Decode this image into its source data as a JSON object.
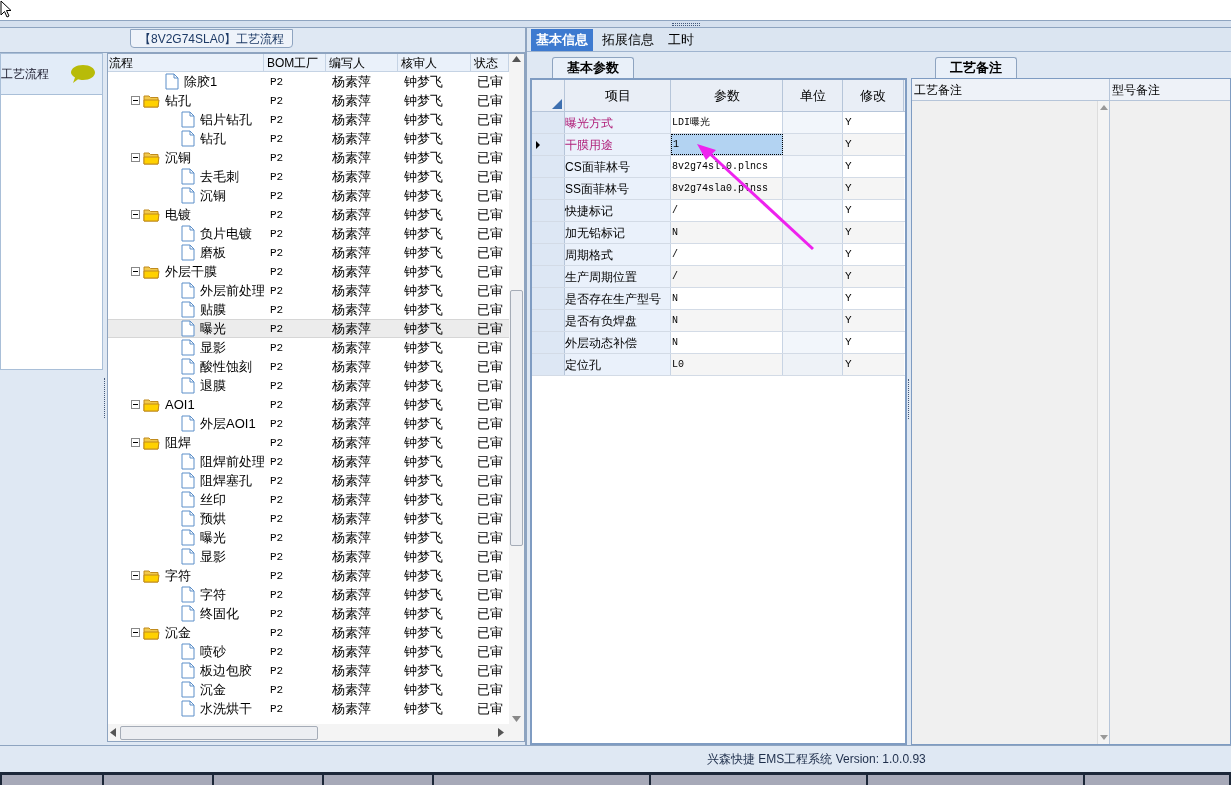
{
  "flow_tab": {
    "title": "【8V2G74SLA0】工艺流程"
  },
  "sidebar": {
    "title": "工艺流程"
  },
  "flow_tree": {
    "columns": [
      "流程",
      "BOM工厂",
      "编写人",
      "核审人",
      "状态"
    ],
    "items": [
      {
        "name": "除胶1",
        "bom": "P2",
        "writer": "杨素萍",
        "reviewer": "钟梦飞",
        "status": "已审",
        "selected": false
      },
      {
        "name": "钻孔",
        "bom": "P2",
        "writer": "杨素萍",
        "reviewer": "钟梦飞",
        "status": "已审",
        "selected": false,
        "expanded": true,
        "children": [
          {
            "name": "铝片钻孔",
            "bom": "P2",
            "writer": "杨素萍",
            "reviewer": "钟梦飞",
            "status": "已审",
            "selected": false
          },
          {
            "name": "钻孔",
            "bom": "P2",
            "writer": "杨素萍",
            "reviewer": "钟梦飞",
            "status": "已审",
            "selected": false
          }
        ]
      },
      {
        "name": "沉铜",
        "bom": "P2",
        "writer": "杨素萍",
        "reviewer": "钟梦飞",
        "status": "已审",
        "selected": false,
        "expanded": true,
        "children": [
          {
            "name": "去毛刺",
            "bom": "P2",
            "writer": "杨素萍",
            "reviewer": "钟梦飞",
            "status": "已审",
            "selected": false
          },
          {
            "name": "沉铜",
            "bom": "P2",
            "writer": "杨素萍",
            "reviewer": "钟梦飞",
            "status": "已审",
            "selected": false
          }
        ]
      },
      {
        "name": "电镀",
        "bom": "P2",
        "writer": "杨素萍",
        "reviewer": "钟梦飞",
        "status": "已审",
        "selected": false,
        "expanded": true,
        "children": [
          {
            "name": "负片电镀",
            "bom": "P2",
            "writer": "杨素萍",
            "reviewer": "钟梦飞",
            "status": "已审",
            "selected": false
          },
          {
            "name": "磨板",
            "bom": "P2",
            "writer": "杨素萍",
            "reviewer": "钟梦飞",
            "status": "已审",
            "selected": false
          }
        ]
      },
      {
        "name": "外层干膜",
        "bom": "P2",
        "writer": "杨素萍",
        "reviewer": "钟梦飞",
        "status": "已审",
        "selected": false,
        "expanded": true,
        "children": [
          {
            "name": "外层前处理",
            "bom": "P2",
            "writer": "杨素萍",
            "reviewer": "钟梦飞",
            "status": "已审",
            "selected": false
          },
          {
            "name": "贴膜",
            "bom": "P2",
            "writer": "杨素萍",
            "reviewer": "钟梦飞",
            "status": "已审",
            "selected": false
          },
          {
            "name": "曝光",
            "bom": "P2",
            "writer": "杨素萍",
            "reviewer": "钟梦飞",
            "status": "已审",
            "selected": true
          },
          {
            "name": "显影",
            "bom": "P2",
            "writer": "杨素萍",
            "reviewer": "钟梦飞",
            "status": "已审",
            "selected": false
          },
          {
            "name": "酸性蚀刻",
            "bom": "P2",
            "writer": "杨素萍",
            "reviewer": "钟梦飞",
            "status": "已审",
            "selected": false
          },
          {
            "name": "退膜",
            "bom": "P2",
            "writer": "杨素萍",
            "reviewer": "钟梦飞",
            "status": "已审",
            "selected": false
          }
        ]
      },
      {
        "name": "AOI1",
        "bom": "P2",
        "writer": "杨素萍",
        "reviewer": "钟梦飞",
        "status": "已审",
        "selected": false,
        "expanded": true,
        "children": [
          {
            "name": "外层AOI1",
            "bom": "P2",
            "writer": "杨素萍",
            "reviewer": "钟梦飞",
            "status": "已审",
            "selected": false
          }
        ]
      },
      {
        "name": "阻焊",
        "bom": "P2",
        "writer": "杨素萍",
        "reviewer": "钟梦飞",
        "status": "已审",
        "selected": false,
        "expanded": true,
        "children": [
          {
            "name": "阻焊前处理",
            "bom": "P2",
            "writer": "杨素萍",
            "reviewer": "钟梦飞",
            "status": "已审",
            "selected": false
          },
          {
            "name": "阻焊塞孔",
            "bom": "P2",
            "writer": "杨素萍",
            "reviewer": "钟梦飞",
            "status": "已审",
            "selected": false
          },
          {
            "name": "丝印",
            "bom": "P2",
            "writer": "杨素萍",
            "reviewer": "钟梦飞",
            "status": "已审",
            "selected": false
          },
          {
            "name": "预烘",
            "bom": "P2",
            "writer": "杨素萍",
            "reviewer": "钟梦飞",
            "status": "已审",
            "selected": false
          },
          {
            "name": "曝光",
            "bom": "P2",
            "writer": "杨素萍",
            "reviewer": "钟梦飞",
            "status": "已审",
            "selected": false
          },
          {
            "name": "显影",
            "bom": "P2",
            "writer": "杨素萍",
            "reviewer": "钟梦飞",
            "status": "已审",
            "selected": false
          }
        ]
      },
      {
        "name": "字符",
        "bom": "P2",
        "writer": "杨素萍",
        "reviewer": "钟梦飞",
        "status": "已审",
        "selected": false,
        "expanded": true,
        "children": [
          {
            "name": "字符",
            "bom": "P2",
            "writer": "杨素萍",
            "reviewer": "钟梦飞",
            "status": "已审",
            "selected": false
          },
          {
            "name": "终固化",
            "bom": "P2",
            "writer": "杨素萍",
            "reviewer": "钟梦飞",
            "status": "已审",
            "selected": false
          }
        ]
      },
      {
        "name": "沉金",
        "bom": "P2",
        "writer": "杨素萍",
        "reviewer": "钟梦飞",
        "status": "已审",
        "selected": false,
        "expanded": true,
        "children": [
          {
            "name": "喷砂",
            "bom": "P2",
            "writer": "杨素萍",
            "reviewer": "钟梦飞",
            "status": "已审",
            "selected": false
          },
          {
            "name": "板边包胶",
            "bom": "P2",
            "writer": "杨素萍",
            "reviewer": "钟梦飞",
            "status": "已审",
            "selected": false
          },
          {
            "name": "沉金",
            "bom": "P2",
            "writer": "杨素萍",
            "reviewer": "钟梦飞",
            "status": "已审",
            "selected": false
          },
          {
            "name": "水洗烘干",
            "bom": "P2",
            "writer": "杨素萍",
            "reviewer": "钟梦飞",
            "status": "已审",
            "selected": false
          }
        ]
      }
    ]
  },
  "tabs": [
    {
      "label": "基本信息",
      "selected": true
    },
    {
      "label": "拓展信息",
      "selected": false
    },
    {
      "label": "工时",
      "selected": false
    }
  ],
  "params": {
    "tab": "基本参数",
    "columns": [
      "项目",
      "参数",
      "单位",
      "修改"
    ],
    "rows": [
      {
        "item": "曝光方式",
        "value": "LDI曝光",
        "modify": "Y",
        "emphasis": true,
        "selected": false
      },
      {
        "item": "干膜用途",
        "value": "1",
        "modify": "Y",
        "emphasis": true,
        "selected": true
      },
      {
        "item": "CS面菲林号",
        "value": "8v2g74sl.0.plncs",
        "modify": "Y",
        "emphasis": false,
        "selected": false
      },
      {
        "item": "SS面菲林号",
        "value": "8v2g74sla0.plnss",
        "modify": "Y",
        "emphasis": false,
        "selected": false
      },
      {
        "item": "快捷标记",
        "value": "/",
        "modify": "Y",
        "emphasis": false,
        "selected": false
      },
      {
        "item": "加无铅标记",
        "value": "N",
        "modify": "Y",
        "emphasis": false,
        "selected": false
      },
      {
        "item": "周期格式",
        "value": "/",
        "modify": "Y",
        "emphasis": false,
        "selected": false
      },
      {
        "item": "生产周期位置",
        "value": "/",
        "modify": "Y",
        "emphasis": false,
        "selected": false
      },
      {
        "item": "是否存在生产型号",
        "value": "N",
        "modify": "Y",
        "emphasis": false,
        "selected": false
      },
      {
        "item": "是否有负焊盘",
        "value": "N",
        "modify": "Y",
        "emphasis": false,
        "selected": false
      },
      {
        "item": "外层动态补偿",
        "value": "N",
        "modify": "Y",
        "emphasis": false,
        "selected": false
      },
      {
        "item": "定位孔",
        "value": "L0",
        "modify": "Y",
        "emphasis": false,
        "selected": false
      }
    ]
  },
  "notes": {
    "tab": "工艺备注",
    "columns": [
      "工艺备注",
      "型号备注"
    ]
  },
  "status_bar": {
    "text": "兴森快捷 EMS工程系统 Version: 1.0.0.93"
  }
}
